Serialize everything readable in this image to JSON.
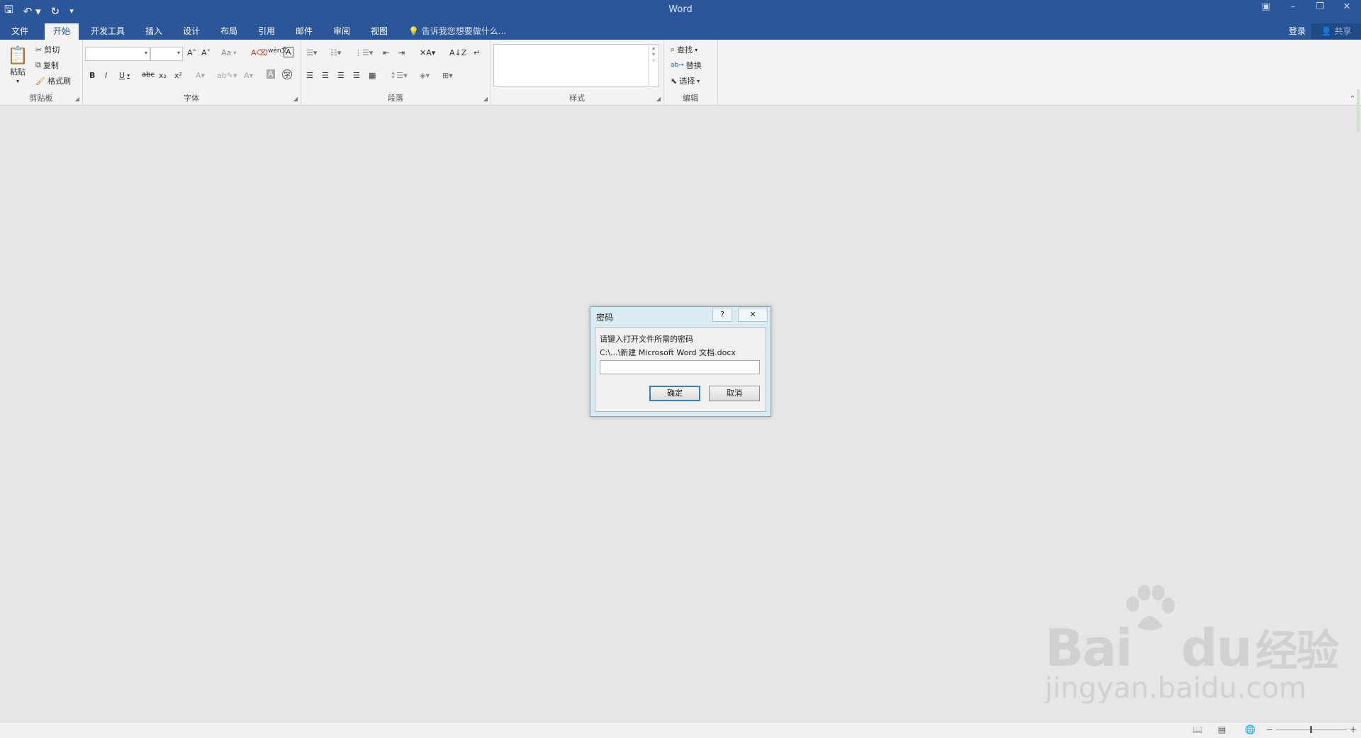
{
  "app": {
    "title": "Word"
  },
  "qat": {
    "save_icon": "save-icon",
    "undo_icon": "undo-icon",
    "redo_icon": "redo-icon",
    "customize_icon": "customize-icon"
  },
  "tabs": [
    "文件",
    "开始",
    "开发工具",
    "插入",
    "设计",
    "布局",
    "引用",
    "邮件",
    "审阅",
    "视图"
  ],
  "active_tab": "开始",
  "tell_me": "告诉我您想要做什么...",
  "account": {
    "login": "登录",
    "share": "共享"
  },
  "ribbon": {
    "clipboard": {
      "label": "剪贴板",
      "paste": "粘贴",
      "cut": "剪切",
      "copy": "复制",
      "format_painter": "格式刷"
    },
    "font": {
      "label": "字体",
      "font_name": "",
      "font_size": "",
      "change_case": "Aa"
    },
    "paragraph": {
      "label": "段落"
    },
    "styles": {
      "label": "样式"
    },
    "editing": {
      "label": "编辑",
      "find": "查找",
      "replace": "替换",
      "select": "选择"
    }
  },
  "dialog": {
    "title": "密码",
    "help": "?",
    "close": "✕",
    "prompt": "请键入打开文件所需的密码",
    "path": "C:\\...\\新建 Microsoft Word 文档.docx",
    "password_value": "",
    "ok": "确定",
    "cancel": "取消"
  },
  "statusbar": {
    "zoom_out": "−",
    "zoom_in": "+"
  },
  "watermark": {
    "brand": "Bai du 经验",
    "url": "jingyan.baidu.com"
  },
  "colors": {
    "accent": "#2b579a",
    "dialog_frame": "#d9ecf2"
  }
}
